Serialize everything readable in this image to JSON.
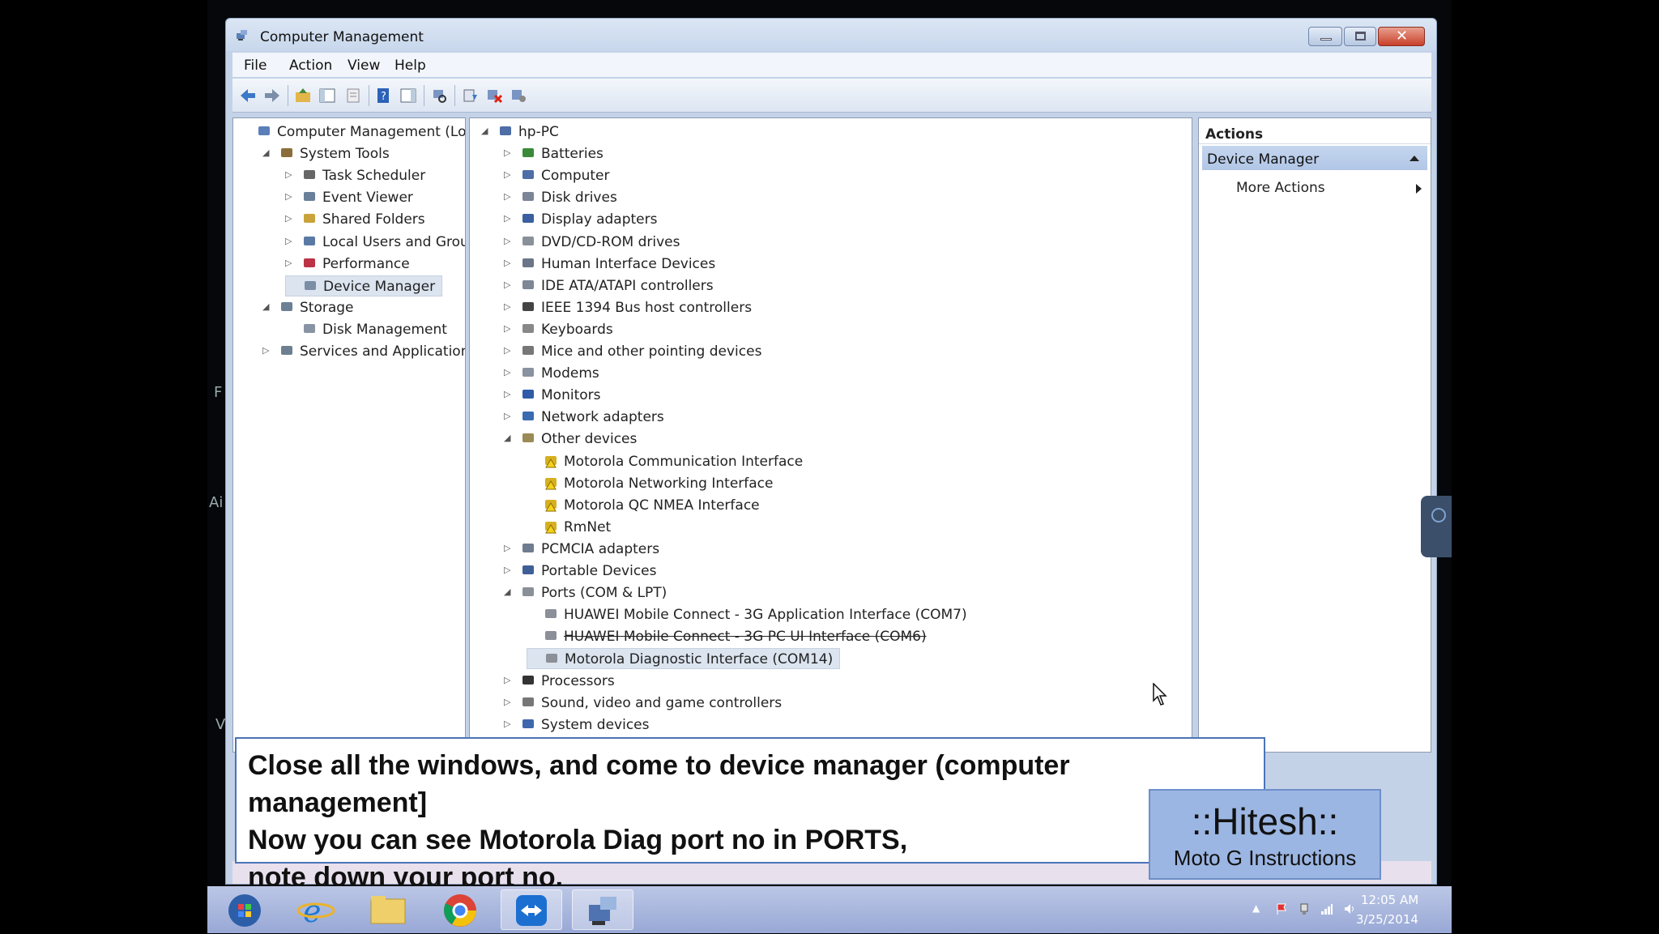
{
  "window": {
    "title": "Computer Management"
  },
  "menu": [
    "File",
    "Action",
    "View",
    "Help"
  ],
  "left_tree": [
    {
      "label": "Computer Management (Local",
      "icon": "computer-management-icon",
      "arrow": "",
      "level": 0
    },
    {
      "label": "System Tools",
      "icon": "tools-icon",
      "arrow": "expanded",
      "level": 1
    },
    {
      "label": "Task Scheduler",
      "icon": "clock-icon",
      "arrow": "collapsed",
      "level": 2
    },
    {
      "label": "Event Viewer",
      "icon": "event-viewer-icon",
      "arrow": "collapsed",
      "level": 2
    },
    {
      "label": "Shared Folders",
      "icon": "shared-folder-icon",
      "arrow": "collapsed",
      "level": 2
    },
    {
      "label": "Local Users and Groups",
      "icon": "users-icon",
      "arrow": "collapsed",
      "level": 2
    },
    {
      "label": "Performance",
      "icon": "performance-icon",
      "arrow": "collapsed",
      "level": 2
    },
    {
      "label": "Device Manager",
      "icon": "device-manager-icon",
      "arrow": "",
      "level": 2,
      "selected": true
    },
    {
      "label": "Storage",
      "icon": "storage-icon",
      "arrow": "expanded",
      "level": 1
    },
    {
      "label": "Disk Management",
      "icon": "disk-icon",
      "arrow": "",
      "level": 2
    },
    {
      "label": "Services and Applications",
      "icon": "services-icon",
      "arrow": "collapsed",
      "level": 1
    }
  ],
  "device_tree": [
    {
      "label": "hp-PC",
      "icon": "computer-icon",
      "arrow": "expanded",
      "level": 0
    },
    {
      "label": "Batteries",
      "icon": "battery-icon",
      "arrow": "collapsed",
      "level": 1
    },
    {
      "label": "Computer",
      "icon": "computer-icon",
      "arrow": "collapsed",
      "level": 1
    },
    {
      "label": "Disk drives",
      "icon": "disk-drive-icon",
      "arrow": "collapsed",
      "level": 1
    },
    {
      "label": "Display adapters",
      "icon": "display-adapter-icon",
      "arrow": "collapsed",
      "level": 1
    },
    {
      "label": "DVD/CD-ROM drives",
      "icon": "dvd-icon",
      "arrow": "collapsed",
      "level": 1
    },
    {
      "label": "Human Interface Devices",
      "icon": "hid-icon",
      "arrow": "collapsed",
      "level": 1
    },
    {
      "label": "IDE ATA/ATAPI controllers",
      "icon": "ide-icon",
      "arrow": "collapsed",
      "level": 1
    },
    {
      "label": "IEEE 1394 Bus host controllers",
      "icon": "firewire-icon",
      "arrow": "collapsed",
      "level": 1
    },
    {
      "label": "Keyboards",
      "icon": "keyboard-icon",
      "arrow": "collapsed",
      "level": 1
    },
    {
      "label": "Mice and other pointing devices",
      "icon": "mouse-icon",
      "arrow": "collapsed",
      "level": 1
    },
    {
      "label": "Modems",
      "icon": "modem-icon",
      "arrow": "collapsed",
      "level": 1
    },
    {
      "label": "Monitors",
      "icon": "monitor-icon",
      "arrow": "collapsed",
      "level": 1
    },
    {
      "label": "Network adapters",
      "icon": "network-icon",
      "arrow": "collapsed",
      "level": 1
    },
    {
      "label": "Other devices",
      "icon": "other-devices-icon",
      "arrow": "expanded",
      "level": 1
    },
    {
      "label": "Motorola Communication Interface",
      "icon": "warning-device-icon",
      "arrow": "",
      "level": 2
    },
    {
      "label": "Motorola Networking Interface",
      "icon": "warning-device-icon",
      "arrow": "",
      "level": 2
    },
    {
      "label": "Motorola QC NMEA Interface",
      "icon": "warning-device-icon",
      "arrow": "",
      "level": 2
    },
    {
      "label": "RmNet",
      "icon": "warning-device-icon",
      "arrow": "",
      "level": 2
    },
    {
      "label": "PCMCIA adapters",
      "icon": "pcmcia-icon",
      "arrow": "collapsed",
      "level": 1
    },
    {
      "label": "Portable Devices",
      "icon": "portable-device-icon",
      "arrow": "collapsed",
      "level": 1
    },
    {
      "label": "Ports (COM & LPT)",
      "icon": "port-icon",
      "arrow": "expanded",
      "level": 1
    },
    {
      "label": "HUAWEI Mobile Connect - 3G Application Interface (COM7)",
      "icon": "port-icon",
      "arrow": "",
      "level": 2
    },
    {
      "label": "HUAWEI Mobile Connect - 3G PC UI Interface (COM6)",
      "icon": "port-icon",
      "arrow": "",
      "level": 2,
      "strike": true
    },
    {
      "label": "Motorola Diagnostic Interface (COM14)",
      "icon": "port-icon",
      "arrow": "",
      "level": 2,
      "selected": true
    },
    {
      "label": "Processors",
      "icon": "processor-icon",
      "arrow": "collapsed",
      "level": 1
    },
    {
      "label": "Sound, video and game controllers",
      "icon": "sound-icon",
      "arrow": "collapsed",
      "level": 1
    },
    {
      "label": "System devices",
      "icon": "system-device-icon",
      "arrow": "collapsed",
      "level": 1
    }
  ],
  "actions": {
    "header": "Actions",
    "section": "Device Manager",
    "more": "More Actions"
  },
  "caption": {
    "line1": "Close all the windows, and come to device manager (computer management]",
    "line2": "Now you can see Motorola Diag port no in PORTS,",
    "line3": "note down your port no."
  },
  "badge": {
    "title": "::Hitesh::",
    "subtitle": "Moto G Instructions"
  },
  "taskbar": {
    "items": [
      "start-orb-icon",
      "internet-explorer-icon",
      "file-explorer-icon",
      "chrome-icon",
      "teamviewer-icon",
      "computer-management-icon"
    ],
    "time": "12:05 AM",
    "date": "3/25/2014"
  },
  "colors": {
    "window_frame": "#c4d2e8",
    "selection": "#dbe4ef",
    "focus_box": "#2b5fa8",
    "badge_bg": "#9cb6e3",
    "taskbar": "#98a8d6"
  }
}
